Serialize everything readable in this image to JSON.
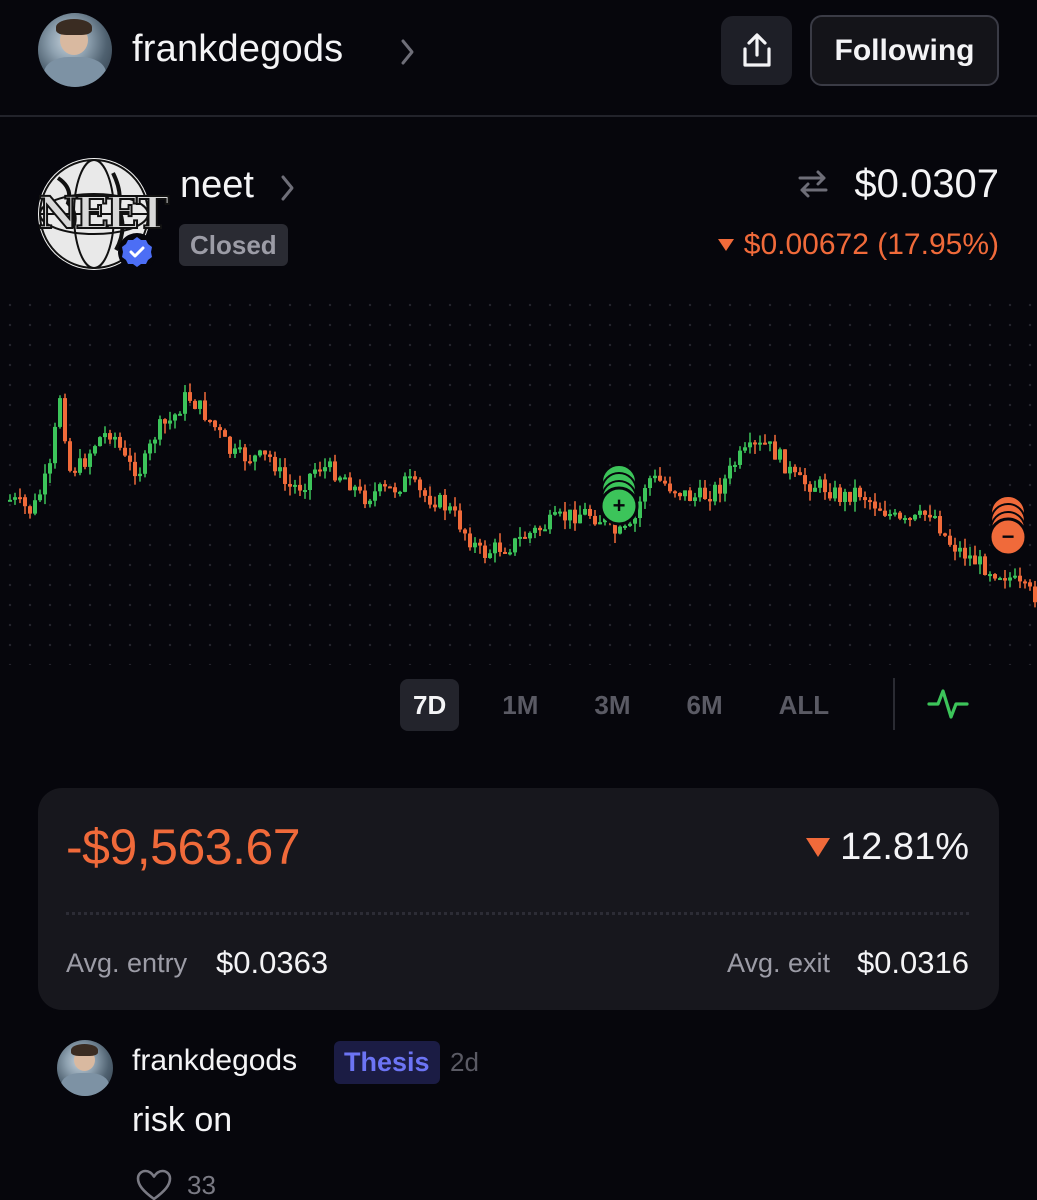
{
  "header": {
    "username": "frankdegods",
    "follow_label": "Following",
    "share_icon": "share-icon",
    "chevron_icon": "chevron-right-icon"
  },
  "token": {
    "name": "neet",
    "logo_text": "NEET",
    "status": "Closed",
    "verified_icon": "verified-badge-icon",
    "price": "$0.0307",
    "change_text": "$0.00672 (17.95%)",
    "change_direction": "down"
  },
  "chart": {
    "range_tabs": [
      "7D",
      "1M",
      "3M",
      "6M",
      "ALL"
    ],
    "active_range": "7D",
    "chart_type_icon": "line-chart-icon",
    "up_color": "#3cc45a",
    "down_color": "#f06a3a",
    "buy_marker_label": "+",
    "sell_marker_label": "−"
  },
  "position": {
    "pnl": "-$9,563.67",
    "pnl_pct": "12.81%",
    "pnl_direction": "down",
    "avg_entry_label": "Avg. entry",
    "avg_entry_value": "$0.0363",
    "avg_exit_label": "Avg. exit",
    "avg_exit_value": "$0.0316"
  },
  "comment": {
    "username": "frankdegods",
    "tag": "Thesis",
    "time": "2d",
    "body": "risk on",
    "likes": "33"
  },
  "colors": {
    "background": "#06060c",
    "negative": "#f06a3a",
    "positive": "#3cc45a",
    "thesis_tag": "#6c74f4"
  }
}
